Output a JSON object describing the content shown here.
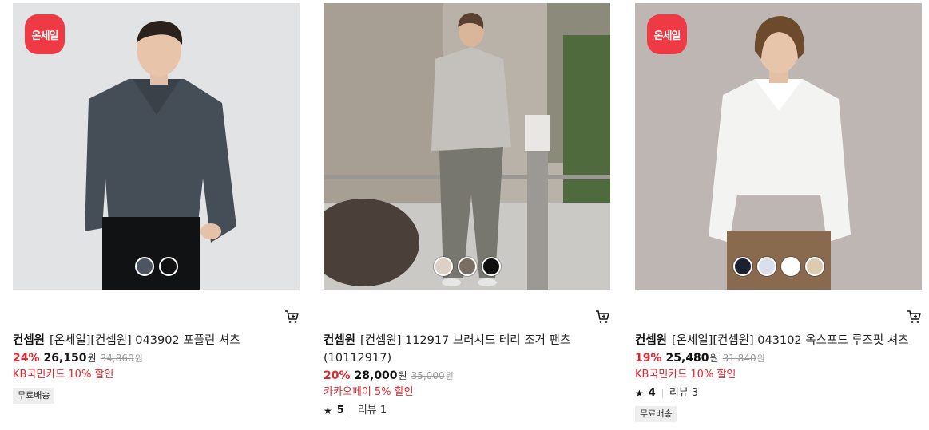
{
  "products": [
    {
      "badge": "온세일",
      "brand": "컨셉원",
      "name": "[온세일][컨셉원] 043902 포플린 셔츠",
      "discount": "24%",
      "price": "26,150",
      "currency": "원",
      "original_price": "34,860",
      "promo": "KB국민카드 10% 할인",
      "tag": "무료배송",
      "swatch_colors": [
        "#4d5660",
        "#111111"
      ]
    },
    {
      "badge": "",
      "brand": "컨셉원",
      "name": "[컨셉원] 112917 브러시드 테리 조거 팬츠 (10112917)",
      "discount": "20%",
      "price": "28,000",
      "currency": "원",
      "original_price": "35,000",
      "promo": "카카오페이 5% 할인",
      "rating": "5",
      "reviews": "리뷰 1",
      "tag": "",
      "swatch_colors": [
        "#ddd1c6",
        "#7a6e63",
        "#0f0f0f"
      ]
    },
    {
      "badge": "온세일",
      "brand": "컨셉원",
      "name": "[온세일][컨셉원] 043102 옥스포드 루즈핏 셔츠",
      "discount": "19%",
      "price": "25,480",
      "currency": "원",
      "original_price": "31,840",
      "promo": "KB국민카드 10% 할인",
      "rating": "4",
      "reviews": "리뷰 3",
      "tag": "무료배송",
      "swatch_colors": [
        "#1c2130",
        "#d9dfeb",
        "#ffffff",
        "#dccbb1"
      ]
    }
  ]
}
